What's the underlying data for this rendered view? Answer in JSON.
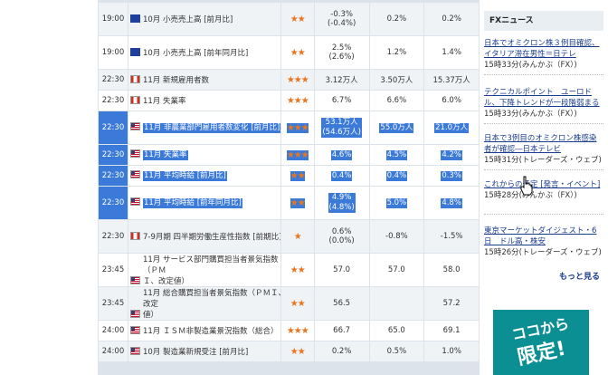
{
  "rows": [
    {
      "time": "19:00",
      "flag": "eu",
      "indicator": "10月 小売売上高 [前月比]",
      "stars": "★★",
      "prev": "-0.3%\n(-0.4%)",
      "forecast": "0.2%",
      "actual": "0.2%",
      "sel": false
    },
    {
      "time": "19:00",
      "flag": "eu",
      "indicator": "10月 小売売上高 [前年同月比]",
      "stars": "★★",
      "prev": "2.5%\n(2.6%)",
      "forecast": "1.2%",
      "actual": "1.4%",
      "sel": false
    },
    {
      "time": "22:30",
      "flag": "ca",
      "indicator": "11月 新規雇用者数",
      "stars": "★★★",
      "prev": "3.12万人",
      "forecast": "3.50万人",
      "actual": "15.37万人",
      "sel": false
    },
    {
      "time": "22:30",
      "flag": "ca",
      "indicator": "11月 失業率",
      "stars": "★★★",
      "prev": "6.7%",
      "forecast": "6.6%",
      "actual": "6.0%",
      "sel": false
    },
    {
      "time": "22:30",
      "flag": "us",
      "indicator": "11月 非農業部門雇用者数変化 [前月比]",
      "stars": "★★★",
      "prev": "53.1万人\n(54.6万人)",
      "forecast": "55.0万人",
      "actual": "21.0万人",
      "sel": true
    },
    {
      "time": "22:30",
      "flag": "us",
      "indicator": "11月 失業率",
      "stars": "★★★",
      "prev": "4.6%",
      "forecast": "4.5%",
      "actual": "4.2%",
      "sel": true
    },
    {
      "time": "22:30",
      "flag": "us",
      "indicator": "11月 平均時給 [前月比]",
      "stars": "★★",
      "prev": "0.4%",
      "forecast": "0.4%",
      "actual": "0.3%",
      "sel": true
    },
    {
      "time": "22:30",
      "flag": "us",
      "indicator": "11月 平均時給 [前年同月比]",
      "stars": "★★",
      "prev": "4.9%\n(4.8%)",
      "forecast": "5.0%",
      "actual": "4.8%",
      "sel": true
    },
    {
      "time": "22:30",
      "flag": "ca",
      "indicator": "7-9月期 四半期労働生産性指数 [前期比]",
      "stars": "★",
      "prev": "0.6%\n(0.0%)",
      "forecast": "-0.8%",
      "actual": "-1.5%",
      "sel": false
    },
    {
      "time": "23:45",
      "flag": "us",
      "indicator": "11月 サービス部門購買担当者景気指数（ＰＭ\nＩ、改定値）",
      "stars": "★★",
      "prev": "57.0",
      "forecast": "57.0",
      "actual": "58.0",
      "sel": false
    },
    {
      "time": "23:45",
      "flag": "us",
      "indicator": "11月 総合購買担当者景気指数（ＰＭＩ、改定\n値）",
      "stars": "★★",
      "prev": "56.5",
      "forecast": "",
      "actual": "57.2",
      "sel": false
    },
    {
      "time": "24:00",
      "flag": "us",
      "indicator": "11月 ＩＳＭ非製造業景況指数（総合）",
      "stars": "★★★",
      "prev": "66.7",
      "forecast": "65.0",
      "actual": "69.1",
      "sel": false
    },
    {
      "time": "24:00",
      "flag": "us",
      "indicator": "10月 製造業新規受注 [前月比]",
      "stars": "★★",
      "prev": "0.2%",
      "forecast": "0.5%",
      "actual": "1.0%",
      "sel": false
    }
  ],
  "sidebar": {
    "title": "FXニュース",
    "news": [
      {
        "title": "日本でオミクロン株３例目確認、イタリア滞在男性＝日テレ",
        "meta": "15時33分(みんかぶ（FX）)"
      },
      {
        "title": "テクニカルポイント　ユーロドル、下降トレンドが一段階弱まる",
        "meta": "15時33分(みんかぶ（FX）)"
      },
      {
        "title": "日本で3例目のオミクロン株感染者が確認―日本テレビ",
        "meta": "15時31分(トレーダーズ・ウェブ)"
      },
      {
        "title": "これからの予定 [発言・イベント]",
        "meta": "15時28分(みんかぶ（FX）)"
      },
      {
        "title": "東京マーケットダイジェスト・6日　ドル高・株安",
        "meta": "15時26分(トレーダーズ・ウェブ)"
      }
    ],
    "more": "もっと見る",
    "banner_line1": "ココから",
    "banner_line2": "限定!"
  }
}
